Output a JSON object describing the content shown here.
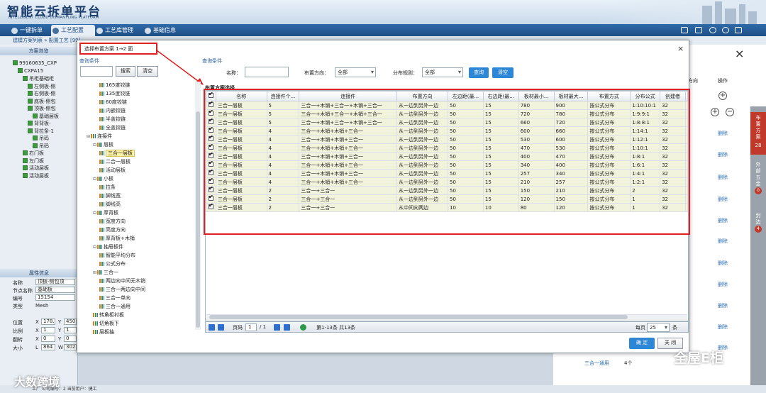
{
  "app": {
    "title_cn": "智能云拆单平台",
    "title_en": "INTELLIGENT CLOUD DISMANTLING PLATFORM"
  },
  "nav": {
    "tabs": [
      "一键拆单",
      "工艺配置",
      "工艺库管理",
      "基础信息"
    ],
    "active": "工艺配置"
  },
  "breadcrumb": "建模方案列表 » 配置工艺 [99]",
  "left_panel": {
    "scheme_header": "方案浏览",
    "tree": [
      {
        "text": "99160635_CXP",
        "depth": 0
      },
      {
        "text": "CXPA15",
        "depth": 1
      },
      {
        "text": "吊柜基础柜",
        "depth": 2
      },
      {
        "text": "左侧板-侧",
        "depth": 3
      },
      {
        "text": "右侧板-侧",
        "depth": 3
      },
      {
        "text": "底板-侧包",
        "depth": 3
      },
      {
        "text": "顶板-侧包",
        "depth": 3
      },
      {
        "text": "基础层板",
        "depth": 4
      },
      {
        "text": "背背板-",
        "depth": 3
      },
      {
        "text": "背拉条-1",
        "depth": 3
      },
      {
        "text": "吊码",
        "depth": 4
      },
      {
        "text": "吊码",
        "depth": 4
      },
      {
        "text": "右门板",
        "depth": 2
      },
      {
        "text": "左门板",
        "depth": 2
      },
      {
        "text": "活动层板",
        "depth": 2
      },
      {
        "text": "活动层板",
        "depth": 2
      }
    ],
    "attr_header": "属性信息",
    "attrs": [
      {
        "label": "名称",
        "value": "顶板-侧包顶"
      },
      {
        "label": "节点名称",
        "value": "基础板"
      },
      {
        "label": "编号",
        "value": "15154"
      },
      {
        "label": "类型",
        "value": "Mesh"
      }
    ],
    "xyz_rows": [
      {
        "label": "位置",
        "x": "178.",
        "y": "450"
      },
      {
        "label": "比例",
        "x": "1",
        "y": "1"
      },
      {
        "label": "翻转",
        "x": "0",
        "y": "0"
      },
      {
        "label": "大小",
        "x": "864",
        "y": "302"
      }
    ],
    "axis_x": "X",
    "axis_y": "Y",
    "size_x": "L",
    "size_y": "W"
  },
  "dialog": {
    "title": "选择布置方案 1→2 面",
    "close": "×",
    "query_label": "查询条件",
    "left_search_btn": "搜索",
    "left_clear_btn": "清空",
    "query": {
      "name_label": "名称：",
      "name_value": "",
      "direction_label": "布置方向：",
      "direction_value": "全部",
      "rule_label": "分布规则：",
      "rule_value": "全部",
      "query_btn": "查询",
      "clear_btn": "清空"
    },
    "tree": [
      {
        "text": "165度铰链",
        "depth": 3
      },
      {
        "text": "135度铰链",
        "depth": 3
      },
      {
        "text": "60度铰链",
        "depth": 3
      },
      {
        "text": "内嵌铰链",
        "depth": 3
      },
      {
        "text": "半盖铰链",
        "depth": 3
      },
      {
        "text": "全盖铰链",
        "depth": 3
      },
      {
        "text": "连接件",
        "depth": 1,
        "toggle": "⊟"
      },
      {
        "text": "层板",
        "depth": 2,
        "toggle": "⊟"
      },
      {
        "text": "三合一层板",
        "depth": 3,
        "selected": true
      },
      {
        "text": "二合一层板",
        "depth": 3
      },
      {
        "text": "活动层板",
        "depth": 3
      },
      {
        "text": "小板",
        "depth": 2,
        "toggle": "⊟"
      },
      {
        "text": "拉条",
        "depth": 3
      },
      {
        "text": "脚线宽",
        "depth": 3
      },
      {
        "text": "脚线高",
        "depth": 3
      },
      {
        "text": "厚背板",
        "depth": 2,
        "toggle": "⊟"
      },
      {
        "text": "宽度方向",
        "depth": 3
      },
      {
        "text": "高度方向",
        "depth": 3
      },
      {
        "text": "厚背板+木销",
        "depth": 3
      },
      {
        "text": "抽屉板件",
        "depth": 2,
        "toggle": "⊟"
      },
      {
        "text": "智能平均分布",
        "depth": 3
      },
      {
        "text": "公式分布",
        "depth": 3
      },
      {
        "text": "三合一",
        "depth": 2,
        "toggle": "⊟"
      },
      {
        "text": "两边向中间无木销",
        "depth": 3
      },
      {
        "text": "三合一两边向中间",
        "depth": 3
      },
      {
        "text": "三合一单向",
        "depth": 3
      },
      {
        "text": "三合一通用",
        "depth": 3
      },
      {
        "text": "转角柜衬板",
        "depth": 2
      },
      {
        "text": "切角板下",
        "depth": 2
      },
      {
        "text": "层板抽",
        "depth": 2
      }
    ],
    "grid_title": "布置方案选择",
    "columns": [
      "名称",
      "连接件个...",
      "连接件",
      "布置方向",
      "左边距(最...",
      "右边距(最...",
      "板材最小...",
      "板材最大...",
      "布置方式",
      "分布公式",
      "创建者"
    ],
    "rows": [
      [
        "三合一层板",
        "5",
        "三合一+木销+三合一+木销+三合一",
        "从一边到另外一边",
        "50",
        "15",
        "780",
        "900",
        "按公式分布",
        "1:10:10:1",
        "32"
      ],
      [
        "三合一层板",
        "5",
        "三合一+木销+三合一+木销+三合一",
        "从一边到另外一边",
        "50",
        "15",
        "720",
        "780",
        "按公式分布",
        "1:9:9:1",
        "32"
      ],
      [
        "三合一层板",
        "5",
        "三合一+木销+三合一+木销+三合一",
        "从一边到另外一边",
        "50",
        "15",
        "660",
        "720",
        "按公式分布",
        "1:8:8:1",
        "32"
      ],
      [
        "三合一层板",
        "4",
        "三合一+木销+木销+三合一",
        "从一边到另外一边",
        "50",
        "15",
        "600",
        "660",
        "按公式分布",
        "1:14:1",
        "32"
      ],
      [
        "三合一层板",
        "4",
        "三合一+木销+木销+三合一",
        "从一边到另外一边",
        "50",
        "15",
        "530",
        "600",
        "按公式分布",
        "1:12:1",
        "32"
      ],
      [
        "三合一层板",
        "4",
        "三合一+木销+木销+三合一",
        "从一边到另外一边",
        "50",
        "15",
        "470",
        "530",
        "按公式分布",
        "1:10:1",
        "32"
      ],
      [
        "三合一层板",
        "4",
        "三合一+木销+木销+三合一",
        "从一边到另外一边",
        "50",
        "15",
        "400",
        "470",
        "按公式分布",
        "1:8:1",
        "32"
      ],
      [
        "三合一层板",
        "4",
        "三合一+木销+木销+三合一",
        "从一边到另外一边",
        "50",
        "15",
        "340",
        "400",
        "按公式分布",
        "1:6:1",
        "32"
      ],
      [
        "三合一层板",
        "4",
        "三合一+木销+木销+三合一",
        "从一边到另外一边",
        "50",
        "15",
        "257",
        "340",
        "按公式分布",
        "1:4:1",
        "32"
      ],
      [
        "三合一层板",
        "4",
        "三合一+木销+木销+三合一",
        "从一边到另外一边",
        "50",
        "15",
        "210",
        "257",
        "按公式分布",
        "1:2:1",
        "32"
      ],
      [
        "三合一层板",
        "2",
        "三合一+三合一",
        "从一边到另外一边",
        "50",
        "15",
        "150",
        "210",
        "按公式分布",
        "2",
        "32"
      ],
      [
        "三合一层板",
        "2",
        "三合一+三合一",
        "从一边到另外一边",
        "50",
        "15",
        "120",
        "150",
        "按公式分布",
        "1",
        "32"
      ],
      [
        "三合一层板",
        "2",
        "三合一+三合一",
        "从中间向两边",
        "10",
        "10",
        "80",
        "120",
        "按公式分布",
        "1",
        "32"
      ]
    ],
    "pager": {
      "page_label": "页码",
      "page_value": "1",
      "total_pages": "/ 1",
      "range": "第1-13条  共13条",
      "per_page_label": "每页",
      "per_page_value": "25",
      "unit": "条"
    },
    "ok_btn": "确 定",
    "close_btn": "关 闭"
  },
  "right_panel": {
    "col_direction": "方向",
    "col_action": "操作",
    "delete_label": "删除",
    "bottom_cell": "三合一通用",
    "bottom_count": "4个",
    "plus": "+",
    "minus": "−",
    "close": "×",
    "side_tabs": [
      {
        "label": "布置方案",
        "badge": "28"
      },
      {
        "label": "外部五金",
        "badge": "0"
      },
      {
        "label": "封边",
        "badge": "4"
      }
    ]
  },
  "footer": "工厂 公司编号：2 当前用户：捷工",
  "watermarks": [
    "全屋E柜",
    "大数跨境"
  ],
  "colors": {
    "accent": "#2e86d6",
    "highlight": "#e02020",
    "nav": "#1e4f86",
    "side_active": "#c0392b"
  }
}
